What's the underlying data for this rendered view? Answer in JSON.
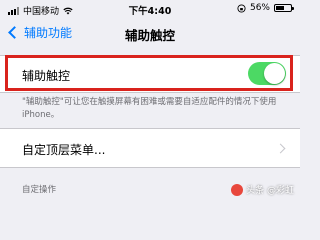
{
  "status_bar": {
    "carrier": "中国移动",
    "time": "下午4:40",
    "battery_percent": "56%",
    "battery_level": 0.56
  },
  "nav": {
    "back_label": "辅助功能",
    "title": "辅助触控"
  },
  "toggle_row": {
    "label": "辅助触控",
    "enabled": true
  },
  "footnote": "\"辅助触控\"可让您在触摸屏幕有困难或需要自适应配件的情况下使用 iPhone。",
  "menu_row": {
    "label": "自定顶层菜单..."
  },
  "section_header": "自定操作",
  "watermark": "头条 @彩虹",
  "colors": {
    "accent": "#007aff",
    "toggle_on": "#4cd964",
    "highlight": "#d9231d"
  }
}
